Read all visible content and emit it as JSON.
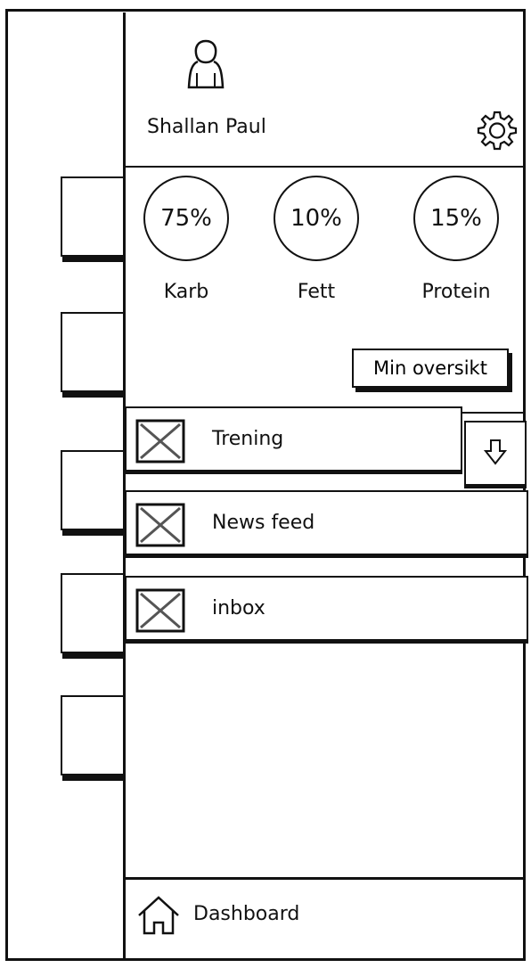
{
  "profile": {
    "name": "Shallan Paul",
    "avatar_icon": "user-avatar-icon",
    "settings_icon": "gear-icon"
  },
  "macros": [
    {
      "percent": "75%",
      "label": "Karb",
      "value": 0.75
    },
    {
      "percent": "10%",
      "label": "Fett",
      "value": 0.1
    },
    {
      "percent": "15%",
      "label": "Protein",
      "value": 0.15
    }
  ],
  "overview_button": {
    "label": "Min oversikt"
  },
  "nav": {
    "items": [
      {
        "label": "Trening",
        "thumb_icon": "image-placeholder-icon"
      },
      {
        "label": "News feed",
        "thumb_icon": "image-placeholder-icon"
      },
      {
        "label": "inbox",
        "thumb_icon": "image-placeholder-icon"
      }
    ],
    "expand_icon": "arrow-down-icon"
  },
  "footer": {
    "label": "Dashboard",
    "icon": "home-icon"
  }
}
